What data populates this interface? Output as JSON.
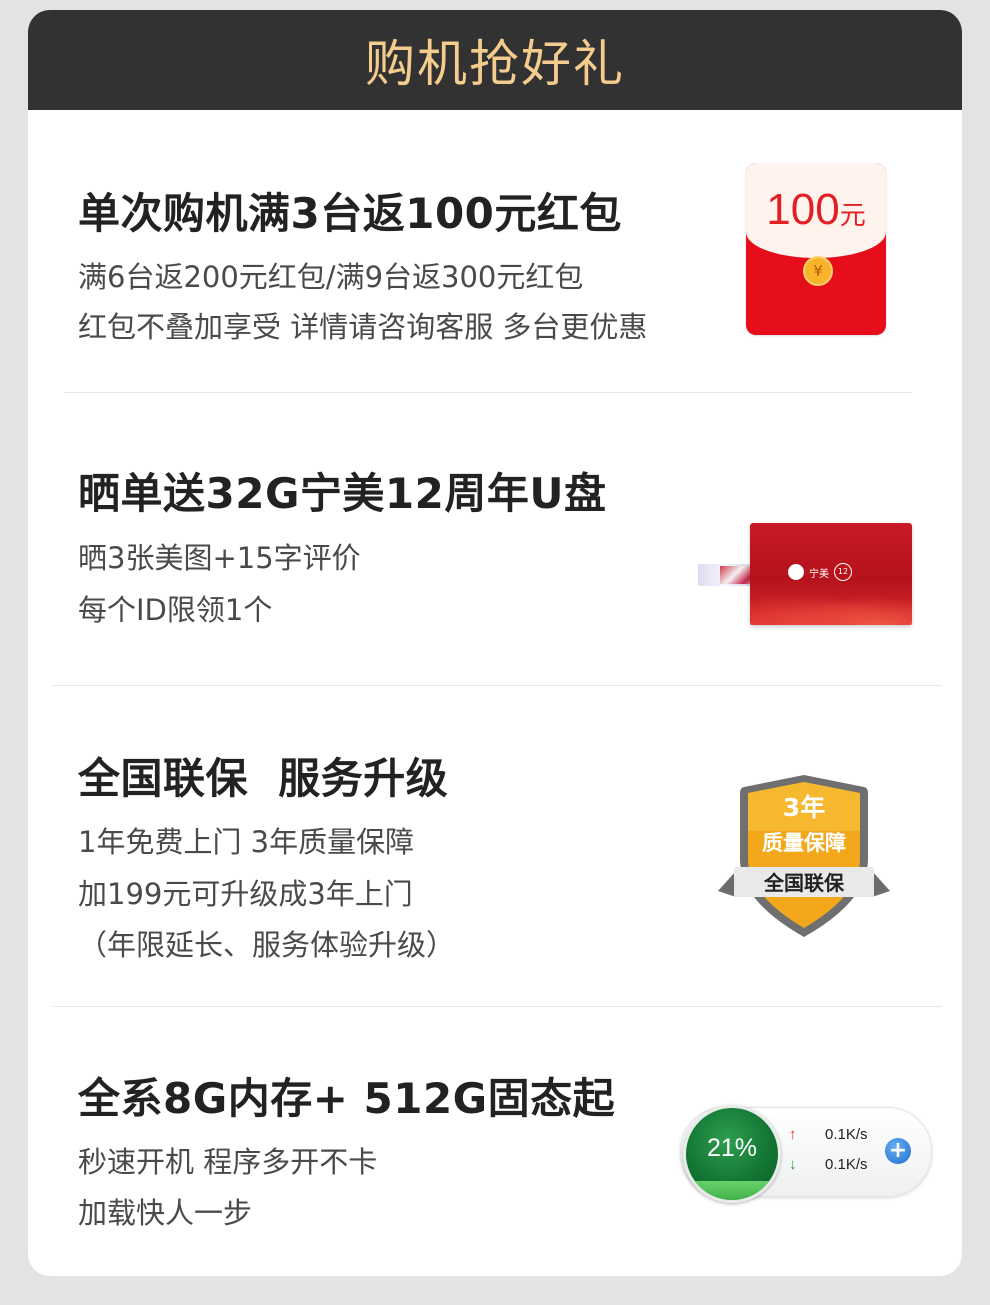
{
  "header": {
    "title": "购机抢好礼"
  },
  "sections": [
    {
      "title": "单次购机满3台返100元红包",
      "lines": [
        "满6台返200元红包/满9台返300元红包",
        "红包不叠加享受 详情请咨询客服 多台更优惠"
      ]
    },
    {
      "title": "晒单送32G宁美12周年U盘",
      "lines": [
        "晒3张美图+15字评价",
        "每个ID限领1个"
      ]
    },
    {
      "title": "全国联保  服务升级",
      "lines": [
        "1年免费上门  3年质量保障",
        "加199元可升级成3年上门",
        "（年限延长、服务体验升级）"
      ]
    },
    {
      "title": "全系8G内存+ 512G固态起",
      "lines": [
        "秒速开机 程序多开不卡",
        "加载快人一步"
      ]
    }
  ],
  "envelope": {
    "amount": "100",
    "unit": "元",
    "coin": "¥"
  },
  "usb": {
    "brand": "宁美",
    "badge": "12"
  },
  "shield": {
    "years": "3年",
    "guarantee": "质量保障",
    "ribbon": "全国联保"
  },
  "speed_widget": {
    "percent": "21%",
    "percent_value": 21,
    "up_arrow": "↑",
    "down_arrow": "↓",
    "upload": "0.1K/s",
    "download": "0.1K/s",
    "plus": "+"
  },
  "colors": {
    "header_bg": "#333232",
    "header_text": "#f3cc8e",
    "envelope_red": "#e60e1b",
    "shield_gold": "#f3a81c",
    "gauge_green": "#137533"
  }
}
